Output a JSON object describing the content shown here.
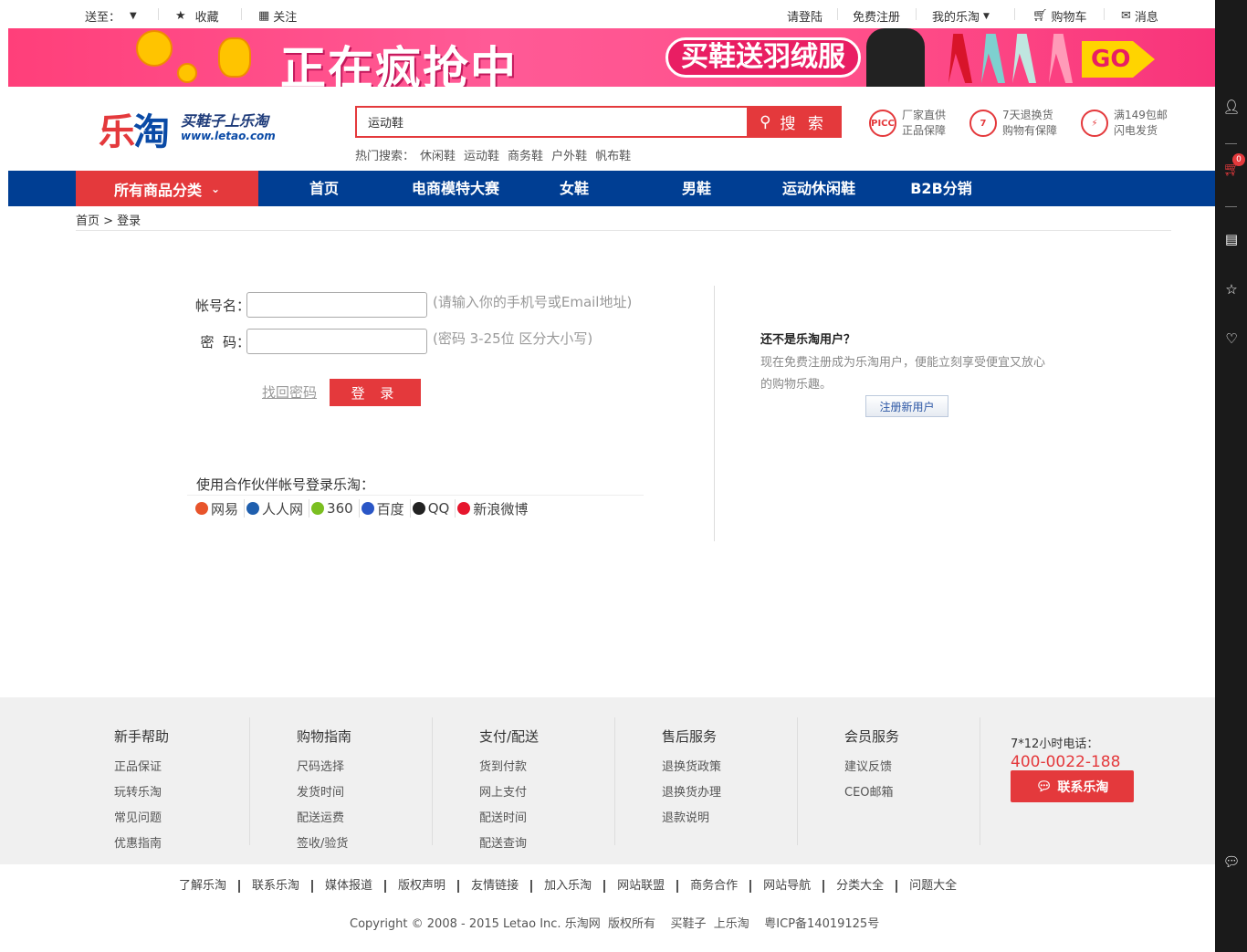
{
  "topbar": {
    "ship_to": "送至：",
    "favorite": "收藏",
    "follow": "关注",
    "login": "请登陆",
    "register": "免费注册",
    "my_letao": "我的乐淘",
    "cart": "购物车",
    "messages": "消息"
  },
  "banner": {
    "headline": "正在疯抢中",
    "promo": "买鞋送羽绒服",
    "go": "GO"
  },
  "header": {
    "logo_text_a": "乐",
    "logo_text_b": "淘",
    "slogan": "买鞋子上乐淘",
    "domain": "www.letao.com",
    "search_value": "运动鞋",
    "search_button": "搜 索",
    "hot_label": "热门搜索：",
    "hot_terms": [
      "休闲鞋",
      "运动鞋",
      "商务鞋",
      "户外鞋",
      "帆布鞋"
    ],
    "promises": [
      {
        "icon": "PICC",
        "line1": "厂家直供",
        "line2": "正品保障"
      },
      {
        "icon": "7",
        "line1": "7天退换货",
        "line2": "购物有保障"
      },
      {
        "icon": "⚡",
        "line1": "满149包邮",
        "line2": "闪电发货"
      }
    ]
  },
  "nav": {
    "category": "所有商品分类",
    "items": [
      "首页",
      "电商模特大赛",
      "女鞋",
      "男鞋",
      "运动休闲鞋",
      "B2B分销"
    ]
  },
  "breadcrumb": "首页 > 登录",
  "login": {
    "account_label": "帐号名：",
    "account_hint": "(请输入你的手机号或Email地址)",
    "password_label": "密  码：",
    "password_hint": "(密码 3-25位 区分大小写)",
    "forgot": "找回密码",
    "submit": "登 录",
    "partner_title": "使用合作伙伴帐号登录乐淘：",
    "partners": [
      {
        "name": "网易",
        "color": "#e8542b"
      },
      {
        "name": "人人网",
        "color": "#1f5fae"
      },
      {
        "name": "360",
        "color": "#7bbf21"
      },
      {
        "name": "百度",
        "color": "#2a56c6"
      },
      {
        "name": "QQ",
        "color": "#222222"
      },
      {
        "name": "新浪微博",
        "color": "#e6162d"
      }
    ]
  },
  "register_panel": {
    "title": "还不是乐淘用户？",
    "desc": "现在免费注册成为乐淘用户，便能立刻享受便宜又放心的购物乐趣。",
    "button": "注册新用户"
  },
  "footer": {
    "columns": [
      {
        "title": "新手帮助",
        "links": [
          "正品保证",
          "玩转乐淘",
          "常见问题",
          "优惠指南"
        ]
      },
      {
        "title": "购物指南",
        "links": [
          "尺码选择",
          "发货时间",
          "配送运费",
          "签收/验货"
        ]
      },
      {
        "title": "支付/配送",
        "links": [
          "货到付款",
          "网上支付",
          "配送时间",
          "配送查询"
        ]
      },
      {
        "title": "售后服务",
        "links": [
          "退换货政策",
          "退换货办理",
          "退款说明"
        ]
      },
      {
        "title": "会员服务",
        "links": [
          "建议反馈",
          "CEO邮箱"
        ]
      }
    ],
    "hotline_label": "7*12小时电话：",
    "hotline": "400-0022-188",
    "contact": "联系乐淘",
    "bottom_links": [
      "了解乐淘",
      "联系乐淘",
      "媒体报道",
      "版权声明",
      "友情链接",
      "加入乐淘",
      "网站联盟",
      "商务合作",
      "网站导航",
      "分类大全",
      "问题大全"
    ],
    "copyright": "Copyright © 2008 - 2015 Letao Inc. 乐淘网  版权所有    买鞋子  上乐淘    粤ICP备14019125号"
  },
  "sidebar": {
    "cart_count": "0"
  },
  "colors": {
    "brand_red": "#e4393c",
    "nav_blue": "#003e93"
  }
}
